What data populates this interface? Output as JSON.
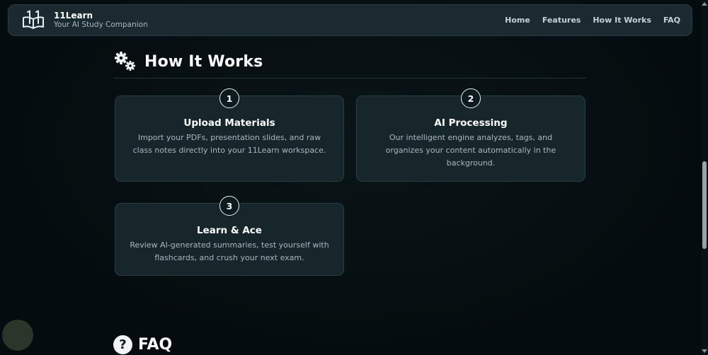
{
  "header": {
    "brand_name": "11Learn",
    "tagline": "Your AI Study Companion",
    "nav": [
      "Home",
      "Features",
      "How It Works",
      "FAQ"
    ]
  },
  "how_it_works": {
    "title": "How It Works",
    "steps": [
      {
        "number": "1",
        "title": "Upload Materials",
        "description": "Import your PDFs, presentation slides, and raw class notes directly into your 11Learn workspace."
      },
      {
        "number": "2",
        "title": "AI Processing",
        "description": "Our intelligent engine analyzes, tags, and organizes your content automatically in the background."
      },
      {
        "number": "3",
        "title": "Learn & Ace",
        "description": "Review AI-generated summaries, test yourself with flashcards, and crush your next exam."
      }
    ]
  },
  "faq": {
    "title": "FAQ",
    "icon_glyph": "?"
  },
  "icons": {
    "logo": "book-logo-icon",
    "section": "gears-icon",
    "faq": "question-circle-icon"
  }
}
